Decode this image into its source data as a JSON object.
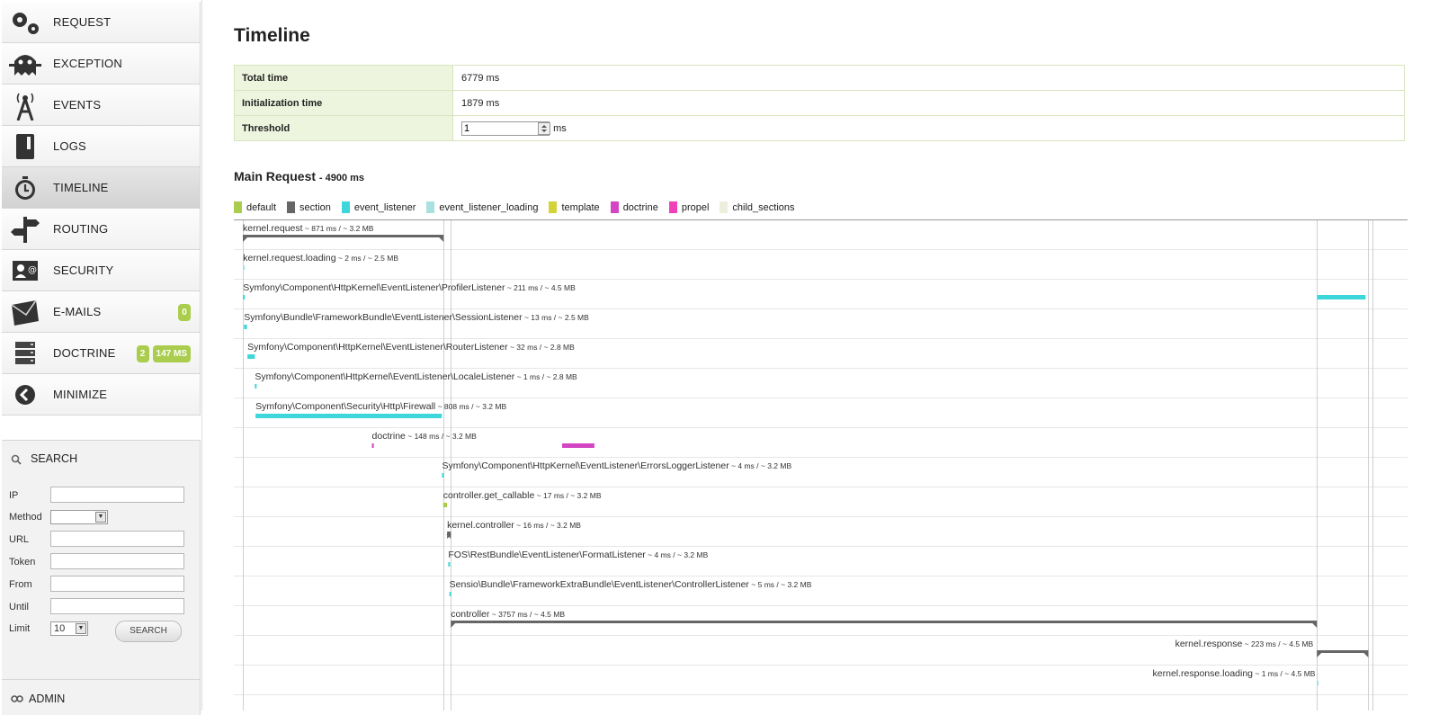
{
  "sidebar": {
    "items": [
      {
        "label": "REQUEST",
        "icon": "gears-icon"
      },
      {
        "label": "EXCEPTION",
        "icon": "ghost-icon"
      },
      {
        "label": "EVENTS",
        "icon": "antenna-icon"
      },
      {
        "label": "LOGS",
        "icon": "book-icon"
      },
      {
        "label": "TIMELINE",
        "icon": "stopwatch-icon",
        "active": true
      },
      {
        "label": "ROUTING",
        "icon": "signpost-icon"
      },
      {
        "label": "SECURITY",
        "icon": "user-card-icon"
      },
      {
        "label": "E-MAILS",
        "icon": "envelope-icon",
        "badges": [
          "0"
        ]
      },
      {
        "label": "DOCTRINE",
        "icon": "database-icon",
        "badges": [
          "2",
          "147 MS"
        ]
      },
      {
        "label": "MINIMIZE",
        "icon": "arrow-left-circle-icon"
      }
    ],
    "search": {
      "title": "SEARCH",
      "fields": [
        {
          "label": "IP",
          "value": ""
        },
        {
          "label": "URL",
          "value": ""
        },
        {
          "label": "Token",
          "value": ""
        },
        {
          "label": "From",
          "value": ""
        },
        {
          "label": "Until",
          "value": ""
        }
      ],
      "method_label": "Method",
      "method_value": "",
      "limit_label": "Limit",
      "limit_value": "10",
      "button_label": "SEARCH"
    },
    "admin_label": "ADMIN"
  },
  "main": {
    "title": "Timeline",
    "summary": {
      "total_time_label": "Total time",
      "total_time_value": "6779 ms",
      "init_time_label": "Initialization time",
      "init_time_value": "1879 ms",
      "threshold_label": "Threshold",
      "threshold_value": "1",
      "threshold_unit": "ms"
    },
    "request_title": "Main Request",
    "request_duration": "- 4900 ms"
  },
  "legend": [
    {
      "name": "default",
      "color": "#aacd4e"
    },
    {
      "name": "section",
      "color": "#666666"
    },
    {
      "name": "event_listener",
      "color": "#3dd7db"
    },
    {
      "name": "event_listener_loading",
      "color": "#a8e1e2"
    },
    {
      "name": "template",
      "color": "#d3d339"
    },
    {
      "name": "doctrine",
      "color": "#d345c3"
    },
    {
      "name": "propel",
      "color": "#f041b9"
    },
    {
      "name": "child_sections",
      "color": "#eeeedd"
    }
  ],
  "timeline": {
    "total_ms": 4900,
    "events": [
      {
        "name": "kernel.request",
        "meta": "~ 871 ms / ~ 3.2 MB",
        "category": "section",
        "periods": [
          [
            0,
            871
          ]
        ]
      },
      {
        "name": "kernel.request.loading",
        "meta": "~ 2 ms / ~ 2.5 MB",
        "category": "event_listener_loading",
        "periods": [
          [
            1,
            3
          ]
        ]
      },
      {
        "name": "Symfony\\Component\\HttpKernel\\EventListener\\ProfilerListener",
        "meta": "~ 211 ms / ~ 4.5 MB",
        "category": "event_listener",
        "periods": [
          [
            1,
            3
          ],
          [
            4660,
            4870
          ]
        ]
      },
      {
        "name": "Symfony\\Bundle\\FrameworkBundle\\EventListener\\SessionListener",
        "meta": "~ 13 ms / ~ 2.5 MB",
        "category": "event_listener",
        "periods": [
          [
            5,
            18
          ]
        ]
      },
      {
        "name": "Symfony\\Component\\HttpKernel\\EventListener\\RouterListener",
        "meta": "~ 32 ms / ~ 2.8 MB",
        "category": "event_listener",
        "periods": [
          [
            20,
            52
          ]
        ]
      },
      {
        "name": "Symfony\\Component\\HttpKernel\\EventListener\\LocaleListener",
        "meta": "~ 1 ms / ~ 2.8 MB",
        "category": "event_listener",
        "periods": [
          [
            52,
            53
          ]
        ]
      },
      {
        "name": "Symfony\\Component\\Security\\Http\\Firewall",
        "meta": "~ 808 ms / ~ 3.2 MB",
        "category": "event_listener",
        "periods": [
          [
            55,
            863
          ]
        ]
      },
      {
        "name": "doctrine",
        "meta": "~ 148 ms / ~ 3.2 MB",
        "category": "doctrine",
        "periods": [
          [
            560,
            568
          ],
          [
            1385,
            1525
          ]
        ]
      },
      {
        "name": "Symfony\\Component\\HttpKernel\\EventListener\\ErrorsLoggerListener",
        "meta": "~ 4 ms / ~ 3.2 MB",
        "category": "event_listener",
        "periods": [
          [
            864,
            868
          ]
        ]
      },
      {
        "name": "controller.get_callable",
        "meta": "~ 17 ms / ~ 3.2 MB",
        "category": "default",
        "periods": [
          [
            869,
            886
          ]
        ]
      },
      {
        "name": "kernel.controller",
        "meta": "~ 16 ms / ~ 3.2 MB",
        "category": "section",
        "periods": [
          [
            886,
            902
          ]
        ]
      },
      {
        "name": "FOS\\RestBundle\\EventListener\\FormatListener",
        "meta": "~ 4 ms / ~ 3.2 MB",
        "category": "event_listener",
        "periods": [
          [
            891,
            895
          ]
        ]
      },
      {
        "name": "Sensio\\Bundle\\FrameworkExtraBundle\\EventListener\\ControllerListener",
        "meta": "~ 5 ms / ~ 3.2 MB",
        "category": "event_listener",
        "periods": [
          [
            896,
            901
          ]
        ]
      },
      {
        "name": "controller",
        "meta": "~ 3757 ms / ~ 4.5 MB",
        "category": "section",
        "periods": [
          [
            902,
            4659
          ]
        ]
      },
      {
        "name": "kernel.response",
        "meta": "~ 223 ms / ~ 4.5 MB",
        "category": "section",
        "periods": [
          [
            4659,
            4882
          ]
        ]
      },
      {
        "name": "kernel.response.loading",
        "meta": "~ 1 ms / ~ 4.5 MB",
        "category": "event_listener_loading",
        "periods": [
          [
            4659,
            4660
          ]
        ]
      }
    ]
  }
}
